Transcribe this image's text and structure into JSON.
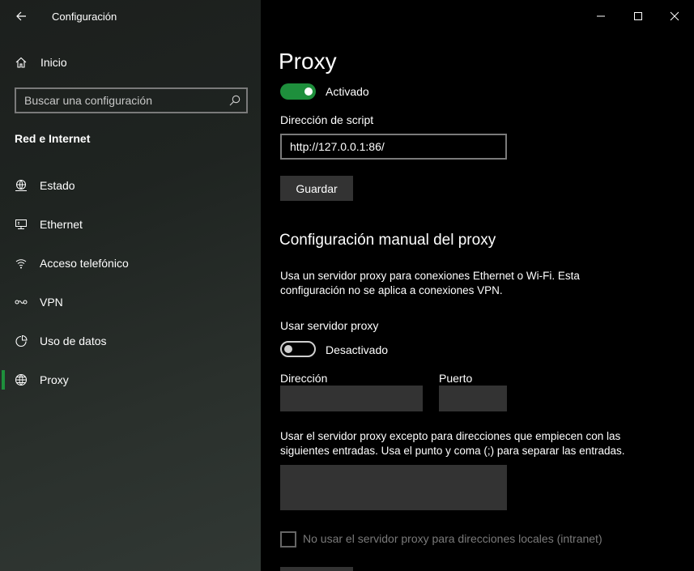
{
  "window": {
    "title": "Configuración",
    "back_icon": "arrow-left-icon",
    "minimize_icon": "minimize-icon",
    "maximize_icon": "maximize-icon",
    "close_icon": "close-icon"
  },
  "sidebar": {
    "home": {
      "label": "Inicio",
      "icon": "home-icon"
    },
    "search": {
      "placeholder": "Buscar una configuración",
      "icon": "search-icon"
    },
    "section_title": "Red e Internet",
    "accent_color": "#1e8f3c",
    "items": [
      {
        "label": "Estado",
        "icon": "globe-status-icon",
        "selected": false
      },
      {
        "label": "Ethernet",
        "icon": "ethernet-icon",
        "selected": false
      },
      {
        "label": "Acceso telefónico",
        "icon": "dialup-icon",
        "selected": false
      },
      {
        "label": "VPN",
        "icon": "vpn-icon",
        "selected": false
      },
      {
        "label": "Uso de datos",
        "icon": "data-usage-icon",
        "selected": false
      },
      {
        "label": "Proxy",
        "icon": "globe-icon",
        "selected": true
      }
    ]
  },
  "main": {
    "title": "Proxy",
    "script_toggle": {
      "state": "on",
      "label": "Activado"
    },
    "script_address": {
      "label": "Dirección de script",
      "value": "http://127.0.0.1:86/"
    },
    "save_button": "Guardar",
    "manual": {
      "heading": "Configuración manual del proxy",
      "description": "Usa un servidor proxy para conexiones Ethernet o Wi-Fi. Esta configuración no se aplica a conexiones VPN.",
      "use_proxy_label": "Usar servidor proxy",
      "toggle": {
        "state": "off",
        "label": "Desactivado"
      },
      "address_label": "Dirección",
      "address_value": "",
      "port_label": "Puerto",
      "port_value": "",
      "exceptions_label": "Usar el servidor proxy excepto para direcciones que empiecen con las siguientes entradas. Usa el punto y coma (;) para separar las entradas.",
      "exceptions_value": "",
      "local_checkbox": {
        "checked": false,
        "label": "No usar el servidor proxy para direcciones locales (intranet)"
      }
    }
  }
}
